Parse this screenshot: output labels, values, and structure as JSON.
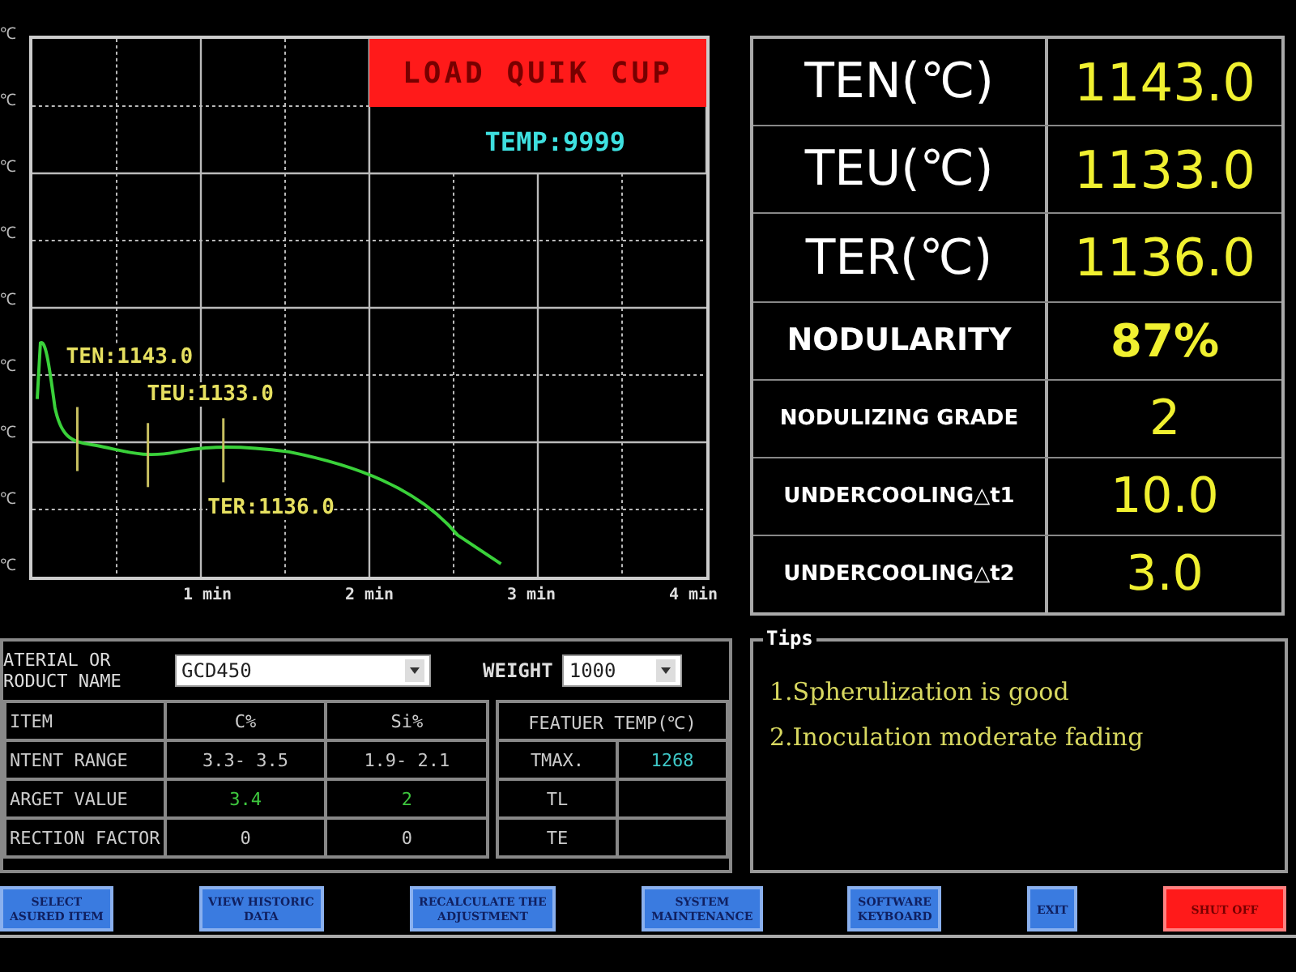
{
  "chart": {
    "banner": "LOAD QUIK CUP",
    "temp_readout": "TEMP:9999",
    "y_tick_labels": [
      "℃",
      "℃",
      "℃",
      "℃",
      "℃",
      "℃",
      "℃",
      "℃",
      "℃"
    ],
    "x_tick_labels": [
      "1 min",
      "2 min",
      "3 min",
      "4 min"
    ],
    "annotations": [
      "TEN:1143.0",
      "TEU:1133.0",
      "TER:1136.0"
    ]
  },
  "results": [
    {
      "label": "TEN(℃)",
      "value": "1143.0"
    },
    {
      "label": "TEU(℃)",
      "value": "1133.0"
    },
    {
      "label": "TER(℃)",
      "value": "1136.0"
    },
    {
      "label": "NODULARITY",
      "value": "87%"
    },
    {
      "label": "NODULIZING GRADE",
      "value": "2"
    },
    {
      "label": "UNDERCOOLING△t1",
      "value": "10.0"
    },
    {
      "label": "UNDERCOOLING△t2",
      "value": "3.0"
    }
  ],
  "material": {
    "label_line_1": "ATERIAL OR",
    "label_line_2": "RODUCT NAME",
    "value": "GCD450",
    "weight_label": "WEIGHT",
    "weight_value": "1000"
  },
  "composition": {
    "columns": [
      "ITEM",
      "C%",
      "Si%"
    ],
    "rows": [
      {
        "label": "NTENT RANGE",
        "values": [
          "3.3- 3.5",
          "1.9- 2.1"
        ],
        "kind": "range"
      },
      {
        "label": "ARGET VALUE",
        "values": [
          "3.4",
          "2"
        ],
        "kind": "target"
      },
      {
        "label": "RECTION FACTOR",
        "values": [
          "0",
          "0"
        ],
        "kind": "factor"
      }
    ]
  },
  "feature_temp": {
    "title": "FEATUER TEMP(℃)",
    "rows": [
      {
        "label": "TMAX.",
        "value": "1268"
      },
      {
        "label": "TL"
      },
      {
        "label": "TE"
      }
    ]
  },
  "tips": {
    "title": "Tips",
    "items": [
      "1.Spherulization is good",
      "2.Inoculation moderate fading"
    ]
  },
  "buttons": [
    {
      "line_1": "SELECT",
      "line_2": "ASURED ITEM",
      "kind": "normal"
    },
    {
      "line_1": "VIEW HISTORIC",
      "line_2": "DATA",
      "kind": "normal"
    },
    {
      "line_1": "RECALCULATE THE",
      "line_2": "ADJUSTMENT",
      "kind": "normal"
    },
    {
      "line_1": "SYSTEM",
      "line_2": "MAINTENANCE",
      "kind": "normal"
    },
    {
      "line_1": "SOFTWARE",
      "line_2": "KEYBOARD",
      "kind": "normal"
    },
    {
      "line_1": "EXIT",
      "kind": "normal"
    },
    {
      "line_1": "SHUT OFF",
      "kind": "danger"
    }
  ]
}
